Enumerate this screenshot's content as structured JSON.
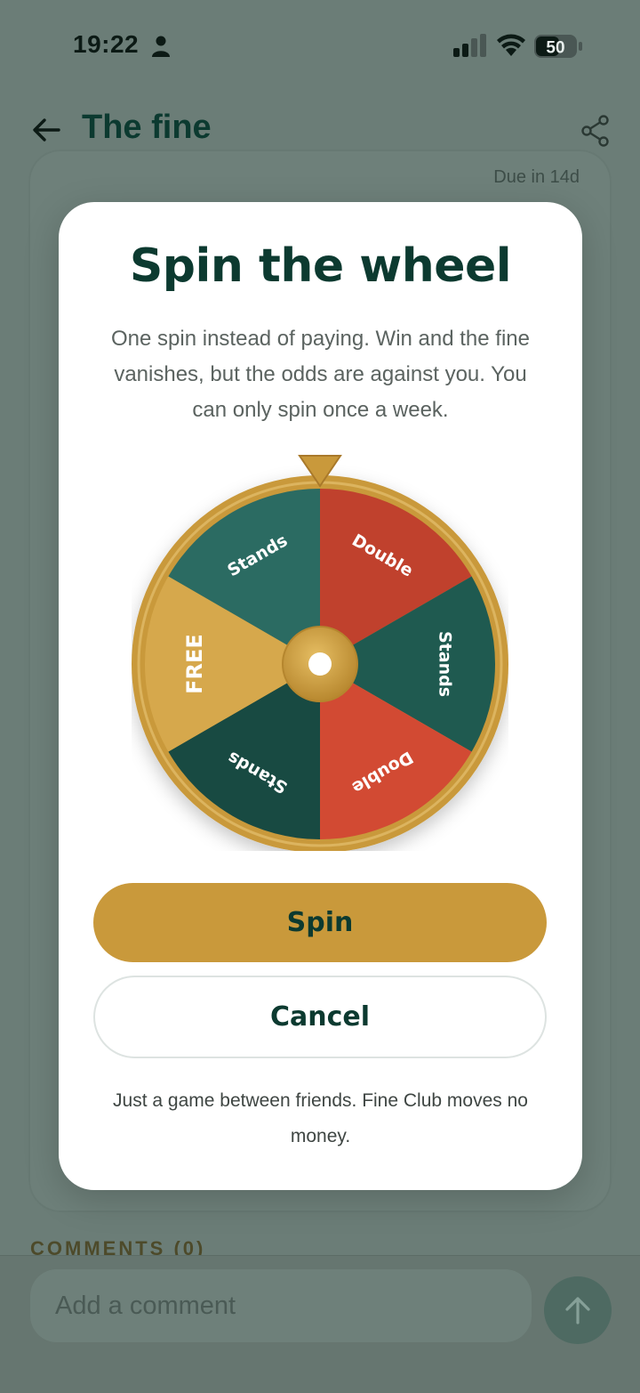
{
  "status_bar": {
    "time": "19:22",
    "battery": "50",
    "icons": [
      "person-icon",
      "signal-icon",
      "wifi-icon",
      "battery-icon"
    ]
  },
  "header": {
    "title": "The fine",
    "back_icon": "back-arrow-icon",
    "share_icon": "share-icon"
  },
  "card": {
    "due": "Due in 14d"
  },
  "comments": {
    "heading": "COMMENTS (0)",
    "placeholder": "Add a comment",
    "send_icon": "arrow-up-icon"
  },
  "modal": {
    "title": "Spin the wheel",
    "description": "One spin instead of paying. Win and the fine vanishes, but the odds are against you. You can only spin once a week.",
    "wheel": {
      "segments": [
        {
          "label": "Double",
          "color": "#c0412d"
        },
        {
          "label": "Stands",
          "color": "#1f5a50"
        },
        {
          "label": "Double",
          "color": "#d24a33"
        },
        {
          "label": "Stands",
          "color": "#184a42"
        },
        {
          "label": "FREE",
          "color": "#d6a84c"
        },
        {
          "label": "Stands",
          "color": "#2b6b62"
        }
      ],
      "rim_color": "#c9993b",
      "pointer_color": "#c9993b"
    },
    "spin_label": "Spin",
    "cancel_label": "Cancel",
    "disclaimer": "Just a game between friends. Fine Club moves no money."
  },
  "colors": {
    "brand_dark": "#0c3a30",
    "accent_gold": "#c9993b",
    "overlay": "#6b7d77"
  }
}
